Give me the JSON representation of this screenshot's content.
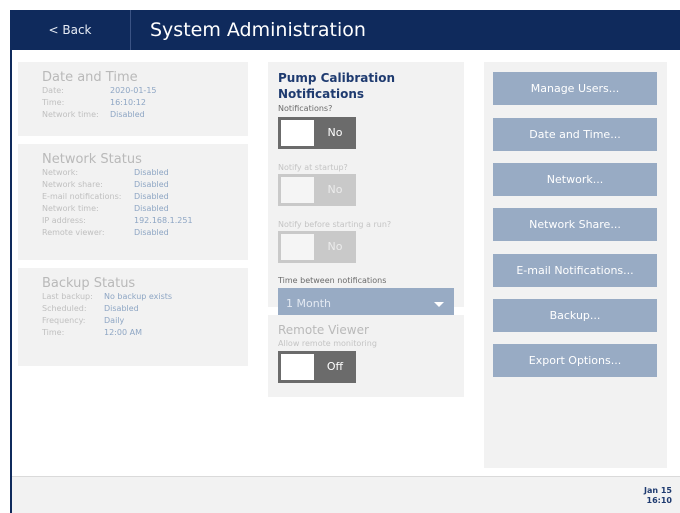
{
  "header": {
    "back_label": "< Back",
    "title": "System Administration"
  },
  "date_time_panel": {
    "title": "Date and Time",
    "rows": [
      {
        "key": "Date:",
        "value": "2020-01-15"
      },
      {
        "key": "Time:",
        "value": "16:10:12"
      },
      {
        "key": "Network time:",
        "value": "Disabled"
      }
    ]
  },
  "network_status_panel": {
    "title": "Network Status",
    "rows": [
      {
        "key": "Network:",
        "value": "Disabled"
      },
      {
        "key": "Network share:",
        "value": "Disabled"
      },
      {
        "key": "E-mail notifications:",
        "value": "Disabled"
      },
      {
        "key": "Network time:",
        "value": "Disabled"
      },
      {
        "key": "IP address:",
        "value": "192.168.1.251"
      },
      {
        "key": "Remote viewer:",
        "value": "Disabled"
      }
    ]
  },
  "backup_status_panel": {
    "title": "Backup Status",
    "rows": [
      {
        "key": "Last backup:",
        "value": "No backup exists"
      },
      {
        "key": "Scheduled:",
        "value": "Disabled"
      },
      {
        "key": "Frequency:",
        "value": "Daily"
      },
      {
        "key": "Time:",
        "value": "12:00 AM"
      }
    ]
  },
  "pump_panel": {
    "title": "Pump Calibration Notifications",
    "notifications_label": "Notifications?",
    "notifications_value": "No",
    "startup_label": "Notify at startup?",
    "startup_value": "No",
    "before_run_label": "Notify before starting a run?",
    "before_run_value": "No",
    "interval_label": "Time between notifications",
    "interval_value": "1 Month"
  },
  "remote_panel": {
    "title": "Remote Viewer",
    "allow_label": "Allow remote monitoring",
    "allow_value": "Off"
  },
  "actions": {
    "manage_users": "Manage Users...",
    "date_time": "Date and Time...",
    "network": "Network...",
    "network_share": "Network Share...",
    "email": "E-mail Notifications...",
    "backup": "Backup...",
    "export": "Export Options..."
  },
  "footer": {
    "date": "Jan 15",
    "time": "16:10"
  },
  "colors": {
    "header_bg": "#0f2a5c",
    "button_bg": "#98abc4",
    "panel_bg": "#f2f2f2",
    "toggle_off": "#6b6b6b"
  }
}
